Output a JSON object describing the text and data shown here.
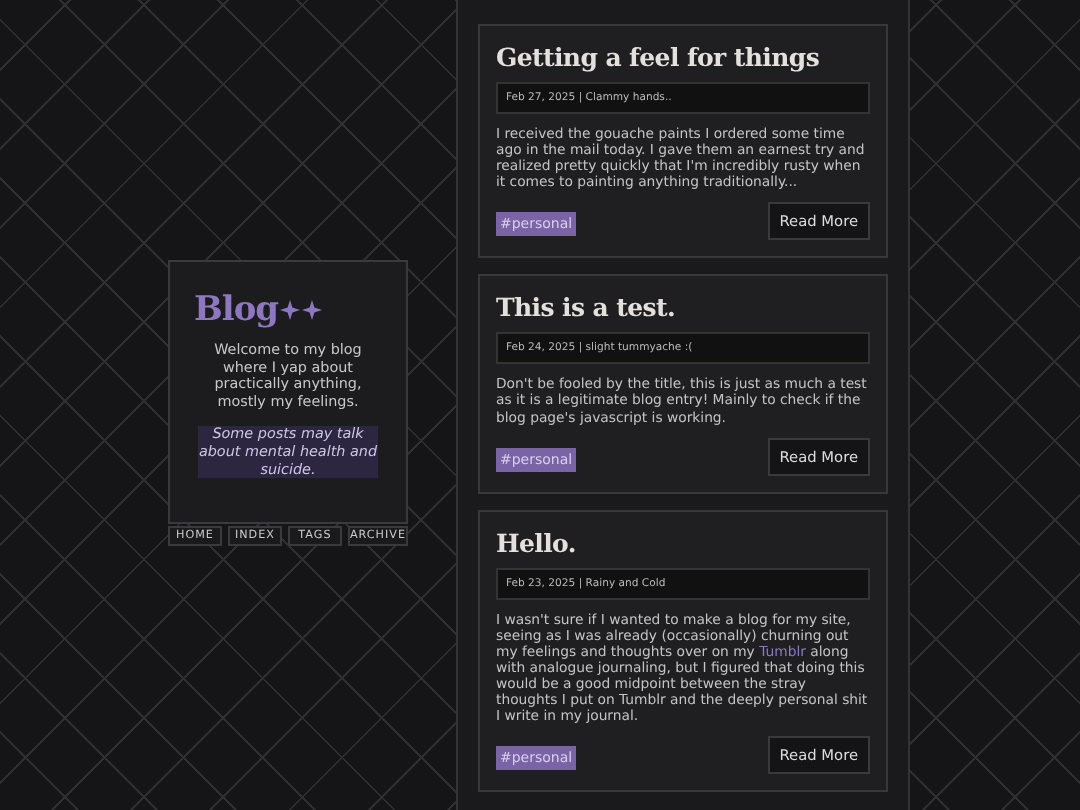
{
  "sidebar": {
    "logo": "Blog",
    "intro": "Welcome to my blog where I yap about practically anything, mostly my feelings.",
    "warning": "Some posts may talk about mental health and suicide.",
    "nav": [
      {
        "label": "HOME"
      },
      {
        "label": "INDEX"
      },
      {
        "label": "TAGS"
      },
      {
        "label": "ARCHIVE"
      }
    ]
  },
  "posts": [
    {
      "title": "Getting a feel for things",
      "meta": "Feb 27, 2025 | Clammy hands..",
      "body": [
        {
          "kind": "text",
          "text": "I received the gouache paints I ordered some time ago in the mail today. I gave them an earnest try and realized pretty quickly that I'm incredibly rusty when it comes to painting anything traditionally..."
        }
      ],
      "tag": "#personal",
      "button": "Read More"
    },
    {
      "title": "This is a test.",
      "meta": "Feb 24, 2025 | slight tummyache :(",
      "body": [
        {
          "kind": "text",
          "text": "Don't be fooled by the title, this is just as much a test as it is a legitimate blog entry! Mainly to check if the blog page's javascript is working."
        }
      ],
      "tag": "#personal",
      "button": "Read More"
    },
    {
      "title": "Hello.",
      "meta": "Feb 23, 2025 | Rainy and Cold",
      "body": [
        {
          "kind": "text",
          "text": "I wasn't sure if I wanted to make a blog for my site, seeing as I was already (occasionally) churning out my feelings and thoughts over on my "
        },
        {
          "kind": "link",
          "text": "Tumblr"
        },
        {
          "kind": "text",
          "text": " along with analogue journaling, but I figured that doing this would be a good midpoint between the stray thoughts I put on Tumblr and the deeply personal shit I write in my journal."
        }
      ],
      "tag": "#personal",
      "button": "Read More"
    }
  ]
}
